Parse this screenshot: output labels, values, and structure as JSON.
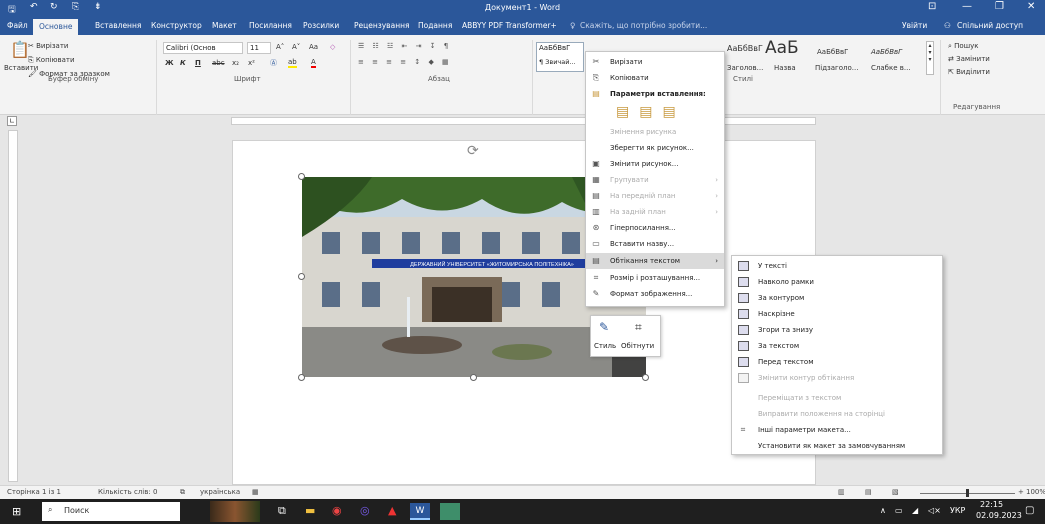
{
  "title_bar": {
    "title": "Документ1 - Word",
    "qa_save": "🖫",
    "qa_undo": "↶",
    "qa_redo": "↻",
    "qa_extra": "⎘",
    "qa_more": "⇟",
    "ribbon_opts": "⊡",
    "minimize": "—",
    "restore": "❐",
    "close": "✕"
  },
  "tabs": [
    "Файл",
    "Основне",
    "Вставлення",
    "Конструктор",
    "Макет",
    "Посилання",
    "Розсилки",
    "Рецензування",
    "Подання",
    "ABBYY PDF Transformer+"
  ],
  "tell_me": "Скажіть, що потрібно зробити...",
  "sign_in": "Увійти",
  "share": "Спільний доступ",
  "clipboard": {
    "paste": "Вставити",
    "cut": "Вирізати",
    "copy": "Копіювати",
    "format_painter": "Формат за зразком",
    "group": "Буфер обміну"
  },
  "font": {
    "name": "Calibri (Основ",
    "size": "11",
    "group": "Шрифт",
    "bold": "Ж",
    "italic": "К",
    "underline": "П",
    "strike": "abc",
    "sub": "x₂",
    "sup": "x²",
    "grow": "A˄",
    "shrink": "A˅",
    "case": "Aa"
  },
  "paragraph": {
    "group": "Абзац"
  },
  "styles": {
    "s1_preview": "АаБбВвГ",
    "s1": "¶ Звичай...",
    "s2_preview": "АаБбВвГ",
    "s2": "Без інте...",
    "s3_preview": "АаБбВвГ",
    "s3": "Заголов...",
    "s4_preview": "АаБ",
    "s4": "Назва",
    "s5_preview": "АаБбВвГ",
    "s5": "Підзаголо...",
    "s6_preview": "АаБбВвГ",
    "s6": "Слабке в...",
    "group": "Стилі"
  },
  "editing": {
    "find": "Пошук",
    "replace": "Замінити",
    "select": "Виділити",
    "group": "Редагування"
  },
  "context_menu": [
    {
      "label": "Вирізати",
      "icon": "✂",
      "disabled": false
    },
    {
      "label": "Копіювати",
      "icon": "⎘",
      "disabled": false
    },
    {
      "label": "Параметри вставлення:",
      "icon": "📋",
      "disabled": false,
      "header": true
    },
    {
      "label": "Змінення рисунка",
      "disabled": true
    },
    {
      "label": "Зберегти як рисунок...",
      "disabled": false
    },
    {
      "label": "Змінити рисунок...",
      "icon": "▣",
      "disabled": false
    },
    {
      "label": "Групувати",
      "icon": "▦",
      "disabled": true,
      "arrow": true
    },
    {
      "label": "На передній план",
      "icon": "▤",
      "disabled": true,
      "arrow": true
    },
    {
      "label": "На задній план",
      "icon": "▥",
      "disabled": true,
      "arrow": true
    },
    {
      "label": "Гіперпосилання...",
      "icon": "🔗",
      "disabled": false
    },
    {
      "label": "Вставити назву...",
      "icon": "▭",
      "disabled": false
    },
    {
      "label": "Обтікання текстом",
      "icon": "▤",
      "disabled": false,
      "arrow": true,
      "highlight": true
    },
    {
      "label": "Розмір і розташування...",
      "icon": "⌗",
      "disabled": false
    },
    {
      "label": "Формат зображення...",
      "icon": "✎",
      "disabled": false
    }
  ],
  "wrap_submenu": [
    {
      "label": "У тексті",
      "disabled": false
    },
    {
      "label": "Навколо рамки",
      "disabled": false
    },
    {
      "label": "За контуром",
      "disabled": false
    },
    {
      "label": "Наскрізне",
      "disabled": false
    },
    {
      "label": "Згори та знизу",
      "disabled": false
    },
    {
      "label": "За текстом",
      "disabled": false
    },
    {
      "label": "Перед текстом",
      "disabled": false
    },
    {
      "label": "Змінити контур обтікання",
      "disabled": true
    },
    {
      "label": "Переміщати з текстом",
      "disabled": true
    },
    {
      "label": "Виправити положення на сторінці",
      "disabled": true
    },
    {
      "label": "Інші параметри макета...",
      "disabled": false
    },
    {
      "label": "Установити як макет за замовчуванням",
      "disabled": false
    }
  ],
  "mini_toolbar": {
    "style": "Стиль",
    "crop": "Обітнути"
  },
  "photo": {
    "banner": "ДЕРЖАВНИЙ УНІВЕРСИТЕТ «ЖИТОМИРСЬКА ПОЛІТЕХНІКА»"
  },
  "status": {
    "page": "Сторінка 1 із 1",
    "words": "Кількість слів: 0",
    "lang": "українська",
    "zoom": "100%"
  },
  "taskbar": {
    "search": "Поиск",
    "lang": "УКР",
    "time": "22:15",
    "date": "02.09.2023"
  },
  "colors": {
    "word_blue": "#2b579a",
    "menu_highlight": "#dadada"
  }
}
